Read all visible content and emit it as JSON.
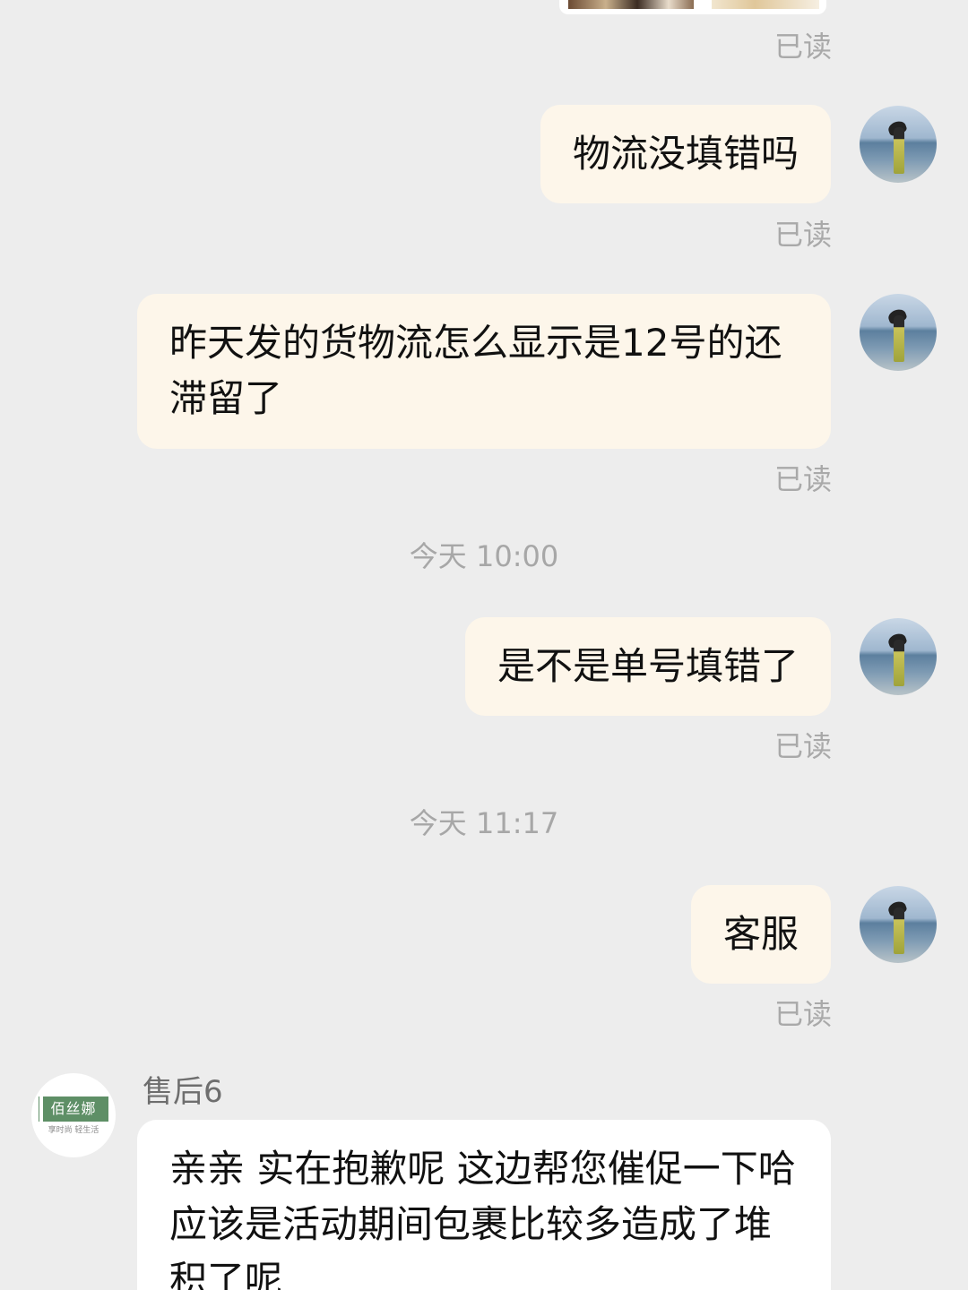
{
  "messages": {
    "read_label": "已读",
    "m1": "物流没填错吗",
    "m2": "昨天发的货物流怎么显示是12号的还滞留了",
    "time1": "今天 10:00",
    "m3": "是不是单号填错了",
    "time2": "今天 11:17",
    "m4": "客服",
    "reply_sender": "售后6",
    "reply_text": "亲亲 实在抱歉呢 这边帮您催促一下哈 应该是活动期间包裹比较多造成了堆积了呢"
  },
  "shop_avatar": {
    "brand": "佰丝娜",
    "tagline": "享时尚 轻生活"
  },
  "colors": {
    "background": "#ededed",
    "my_bubble": "#fdf6ea",
    "other_bubble": "#ffffff",
    "meta_text": "#a9a9a9"
  }
}
